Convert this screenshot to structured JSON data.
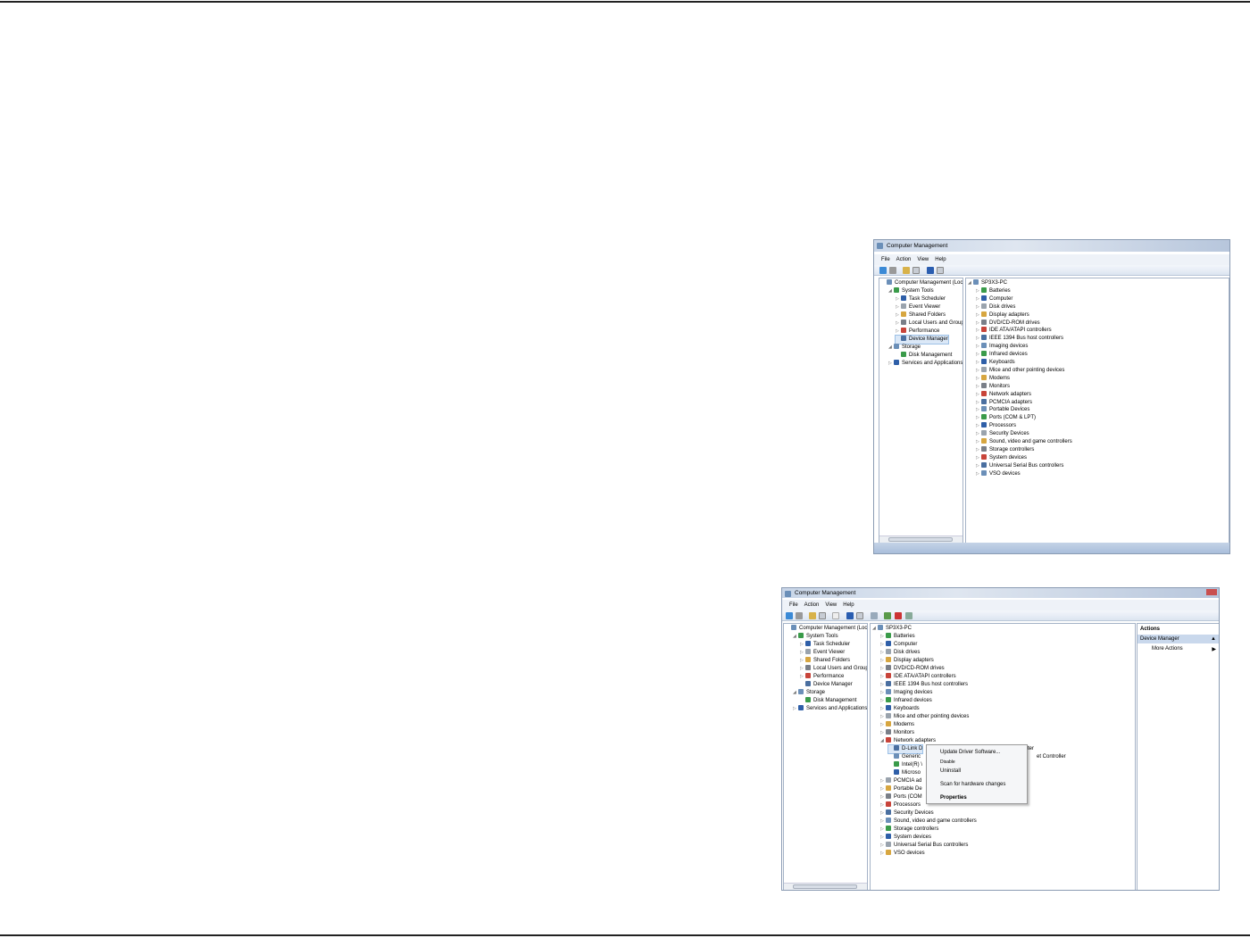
{
  "screenshot1": {
    "title": "Computer Management",
    "menu": [
      "File",
      "Action",
      "View",
      "Help"
    ],
    "left_tree": [
      {
        "label": "Computer Management (Local",
        "level": 0,
        "exp": ""
      },
      {
        "label": "System Tools",
        "level": 1,
        "exp": "open"
      },
      {
        "label": "Task Scheduler",
        "level": 2,
        "exp": "closed"
      },
      {
        "label": "Event Viewer",
        "level": 2,
        "exp": "closed"
      },
      {
        "label": "Shared Folders",
        "level": 2,
        "exp": "closed"
      },
      {
        "label": "Local Users and Groups",
        "level": 2,
        "exp": "closed"
      },
      {
        "label": "Performance",
        "level": 2,
        "exp": "closed"
      },
      {
        "label": "Device Manager",
        "level": 2,
        "exp": "",
        "selected": true
      },
      {
        "label": "Storage",
        "level": 1,
        "exp": "open"
      },
      {
        "label": "Disk Management",
        "level": 2,
        "exp": ""
      },
      {
        "label": "Services and Applications",
        "level": 1,
        "exp": "closed"
      }
    ],
    "device_tree": [
      {
        "label": "SP3X3-PC",
        "level": 0,
        "exp": "open"
      },
      {
        "label": "Batteries",
        "level": 1,
        "exp": "closed"
      },
      {
        "label": "Computer",
        "level": 1,
        "exp": "closed"
      },
      {
        "label": "Disk drives",
        "level": 1,
        "exp": "closed"
      },
      {
        "label": "Display adapters",
        "level": 1,
        "exp": "closed"
      },
      {
        "label": "DVD/CD-ROM drives",
        "level": 1,
        "exp": "closed"
      },
      {
        "label": "IDE ATA/ATAPI controllers",
        "level": 1,
        "exp": "closed"
      },
      {
        "label": "IEEE 1394 Bus host controllers",
        "level": 1,
        "exp": "closed"
      },
      {
        "label": "Imaging devices",
        "level": 1,
        "exp": "closed"
      },
      {
        "label": "Infrared devices",
        "level": 1,
        "exp": "closed"
      },
      {
        "label": "Keyboards",
        "level": 1,
        "exp": "closed"
      },
      {
        "label": "Mice and other pointing devices",
        "level": 1,
        "exp": "closed"
      },
      {
        "label": "Modems",
        "level": 1,
        "exp": "closed"
      },
      {
        "label": "Monitors",
        "level": 1,
        "exp": "closed"
      },
      {
        "label": "Network adapters",
        "level": 1,
        "exp": "closed"
      },
      {
        "label": "PCMCIA adapters",
        "level": 1,
        "exp": "closed"
      },
      {
        "label": "Portable Devices",
        "level": 1,
        "exp": "closed"
      },
      {
        "label": "Ports (COM & LPT)",
        "level": 1,
        "exp": "closed"
      },
      {
        "label": "Processors",
        "level": 1,
        "exp": "closed"
      },
      {
        "label": "Security Devices",
        "level": 1,
        "exp": "closed"
      },
      {
        "label": "Sound, video and game controllers",
        "level": 1,
        "exp": "closed"
      },
      {
        "label": "Storage controllers",
        "level": 1,
        "exp": "closed"
      },
      {
        "label": "System devices",
        "level": 1,
        "exp": "closed"
      },
      {
        "label": "Universal Serial Bus controllers",
        "level": 1,
        "exp": "closed"
      },
      {
        "label": "VSO devices",
        "level": 1,
        "exp": "closed"
      }
    ]
  },
  "screenshot2": {
    "title": "Computer Management",
    "menu": [
      "File",
      "Action",
      "View",
      "Help"
    ],
    "left_tree": [
      {
        "label": "Computer Management (Local",
        "level": 0,
        "exp": ""
      },
      {
        "label": "System Tools",
        "level": 1,
        "exp": "open"
      },
      {
        "label": "Task Scheduler",
        "level": 2,
        "exp": "closed"
      },
      {
        "label": "Event Viewer",
        "level": 2,
        "exp": "closed"
      },
      {
        "label": "Shared Folders",
        "level": 2,
        "exp": "closed"
      },
      {
        "label": "Local Users and Groups",
        "level": 2,
        "exp": "closed"
      },
      {
        "label": "Performance",
        "level": 2,
        "exp": "closed"
      },
      {
        "label": "Device Manager",
        "level": 2,
        "exp": ""
      },
      {
        "label": "Storage",
        "level": 1,
        "exp": "open"
      },
      {
        "label": "Disk Management",
        "level": 2,
        "exp": ""
      },
      {
        "label": "Services and Applications",
        "level": 1,
        "exp": "closed"
      }
    ],
    "device_tree": [
      {
        "label": "SP3X3-PC",
        "level": 0,
        "exp": "open"
      },
      {
        "label": "Batteries",
        "level": 1,
        "exp": "closed"
      },
      {
        "label": "Computer",
        "level": 1,
        "exp": "closed"
      },
      {
        "label": "Disk drives",
        "level": 1,
        "exp": "closed"
      },
      {
        "label": "Display adapters",
        "level": 1,
        "exp": "closed"
      },
      {
        "label": "DVD/CD-ROM drives",
        "level": 1,
        "exp": "closed"
      },
      {
        "label": "IDE ATA/ATAPI controllers",
        "level": 1,
        "exp": "closed"
      },
      {
        "label": "IEEE 1394 Bus host controllers",
        "level": 1,
        "exp": "closed"
      },
      {
        "label": "Imaging devices",
        "level": 1,
        "exp": "closed"
      },
      {
        "label": "Infrared devices",
        "level": 1,
        "exp": "closed"
      },
      {
        "label": "Keyboards",
        "level": 1,
        "exp": "closed"
      },
      {
        "label": "Mice and other pointing devices",
        "level": 1,
        "exp": "closed"
      },
      {
        "label": "Modems",
        "level": 1,
        "exp": "closed"
      },
      {
        "label": "Monitors",
        "level": 1,
        "exp": "closed"
      },
      {
        "label": "Network adapters",
        "level": 1,
        "exp": "open"
      },
      {
        "label": "D-Link D",
        "level": 2,
        "exp": "",
        "selected": true,
        "tail": "ter"
      },
      {
        "label": "Generic",
        "level": 2,
        "exp": "",
        "tail": "et Controller"
      },
      {
        "label": "Intel(R) \\",
        "level": 2,
        "exp": ""
      },
      {
        "label": "Microso",
        "level": 2,
        "exp": ""
      },
      {
        "label": "PCMCIA ad",
        "level": 1,
        "exp": "closed"
      },
      {
        "label": "Portable De",
        "level": 1,
        "exp": "closed"
      },
      {
        "label": "Ports (COM",
        "level": 1,
        "exp": "closed"
      },
      {
        "label": "Processors",
        "level": 1,
        "exp": "closed"
      },
      {
        "label": "Security Devices",
        "level": 1,
        "exp": "closed"
      },
      {
        "label": "Sound, video and game controllers",
        "level": 1,
        "exp": "closed"
      },
      {
        "label": "Storage controllers",
        "level": 1,
        "exp": "closed"
      },
      {
        "label": "System devices",
        "level": 1,
        "exp": "closed"
      },
      {
        "label": "Universal Serial Bus controllers",
        "level": 1,
        "exp": "closed"
      },
      {
        "label": "VSO devices",
        "level": 1,
        "exp": "closed"
      }
    ],
    "actions": {
      "header": "Actions",
      "section": "Device Manager",
      "more": "More Actions"
    },
    "context_menu": [
      "Update Driver Software...",
      "Disable",
      "Uninstall",
      "Scan for hardware changes",
      "Properties"
    ]
  }
}
